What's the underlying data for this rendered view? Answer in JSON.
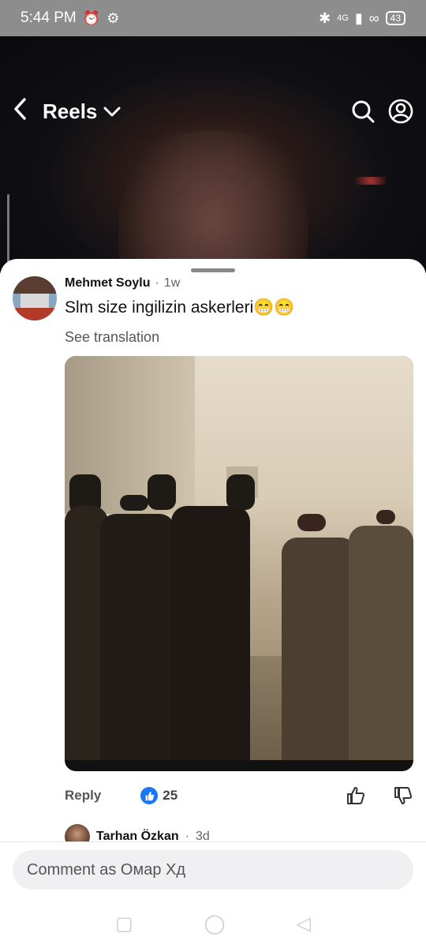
{
  "status_bar": {
    "time": "5:44 PM",
    "alarm_icon": "alarm-icon",
    "settings_icon": "gear-icon",
    "network": "4G",
    "battery": "43"
  },
  "header": {
    "title": "Reels",
    "back_icon": "back-arrow-icon",
    "dropdown_icon": "chevron-down-icon",
    "search_icon": "search-icon",
    "profile_icon": "profile-icon"
  },
  "comment": {
    "author": "Mehmet Soylu",
    "separator": "·",
    "time_ago": "1w",
    "text": "Slm size ingilizin askerleri😁😁",
    "see_translation": "See translation",
    "reply_label": "Reply",
    "like_count": "25"
  },
  "next_comment": {
    "author": "Tarhan Özkan",
    "separator": "·",
    "time_ago": "3d"
  },
  "composer": {
    "placeholder": "Comment as Омар Хд"
  },
  "colors": {
    "like_blue": "#1877f2",
    "status_bar": "#8d8d8d"
  }
}
